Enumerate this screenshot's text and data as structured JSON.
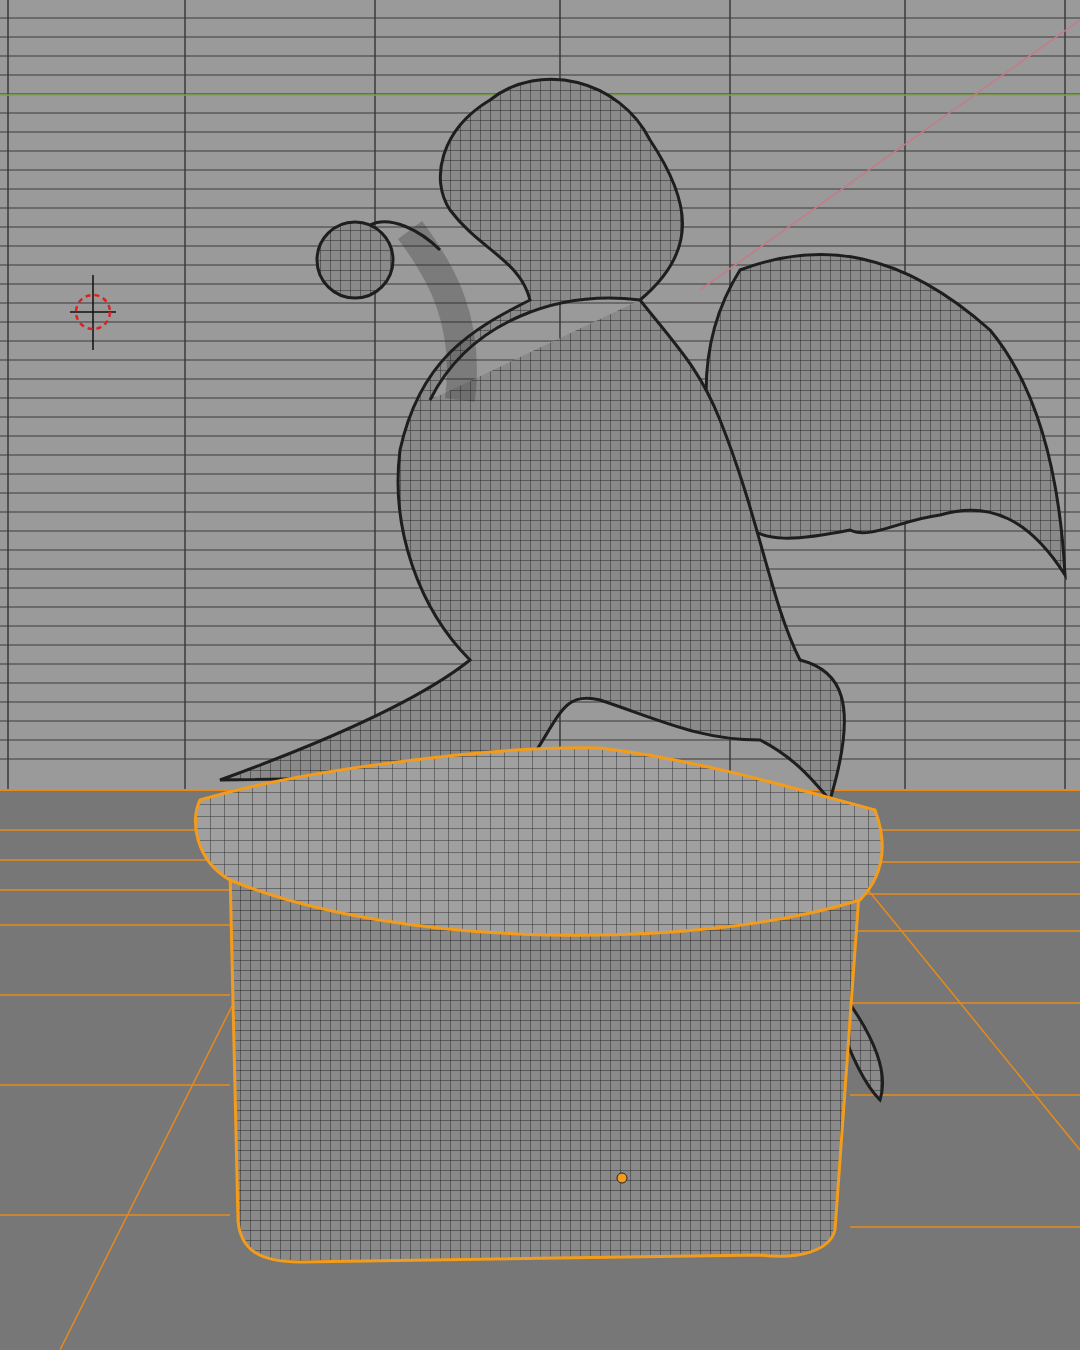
{
  "viewport": {
    "objects": [
      {
        "kind": "dragon",
        "selected": false
      },
      {
        "kind": "pedestal",
        "selected": true
      }
    ]
  }
}
